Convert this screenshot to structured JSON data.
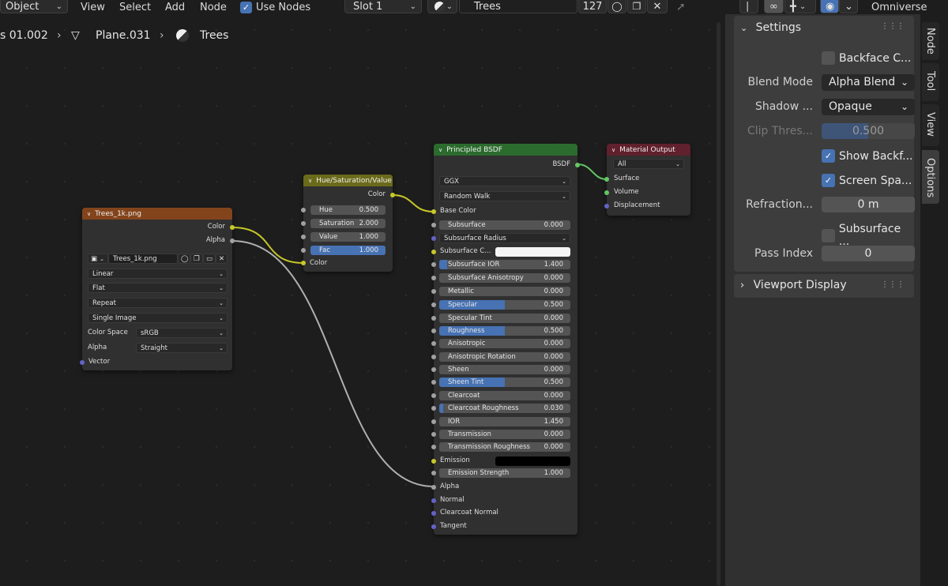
{
  "header": {
    "mode": "Object",
    "menus": [
      "View",
      "Select",
      "Add",
      "Node"
    ],
    "use_nodes_label": "Use Nodes",
    "slot": "Slot 1",
    "material_name": "Trees",
    "user_count": "127",
    "panel_label": "Omniverse"
  },
  "breadcrumb": {
    "item1": "s 01.002",
    "item2": "Plane.031",
    "item3": "Trees"
  },
  "image_node": {
    "title": "Trees_1k.png",
    "out_color": "Color",
    "out_alpha": "Alpha",
    "image_name": "Trees_1k.png",
    "interpolation": "Linear",
    "projection": "Flat",
    "extension": "Repeat",
    "source": "Single Image",
    "color_space_label": "Color Space",
    "color_space": "sRGB",
    "alpha_label": "Alpha",
    "alpha_mode": "Straight",
    "in_vector": "Vector"
  },
  "hsv_node": {
    "title": "Hue/Saturation/Value",
    "out_color": "Color",
    "hue_label": "Hue",
    "hue": "0.500",
    "sat_label": "Saturation",
    "sat": "2.000",
    "val_label": "Value",
    "val": "1.000",
    "fac_label": "Fac",
    "fac": "1.000",
    "in_color": "Color"
  },
  "bsdf_node": {
    "title": "Principled BSDF",
    "out_bsdf": "BSDF",
    "distribution": "GGX",
    "subsurface_method": "Random Walk",
    "base_color": "Base Color",
    "subsurface_radius": "Subsurface Radius",
    "subsurface_color": "Subsurface C...",
    "emission": "Emission",
    "alpha": "Alpha",
    "normal": "Normal",
    "clearcoat_normal": "Clearcoat Normal",
    "tangent": "Tangent",
    "fields": [
      {
        "label": "Subsurface",
        "value": "0.000",
        "fill": 0
      },
      {
        "label": "Subsurface IOR",
        "value": "1.400",
        "fill": 0.06
      },
      {
        "label": "Subsurface Anisotropy",
        "value": "0.000",
        "fill": 0
      },
      {
        "label": "Metallic",
        "value": "0.000",
        "fill": 0
      },
      {
        "label": "Specular",
        "value": "0.500",
        "fill": 0.5
      },
      {
        "label": "Specular Tint",
        "value": "0.000",
        "fill": 0
      },
      {
        "label": "Roughness",
        "value": "0.500",
        "fill": 0.5
      },
      {
        "label": "Anisotropic",
        "value": "0.000",
        "fill": 0
      },
      {
        "label": "Anisotropic Rotation",
        "value": "0.000",
        "fill": 0
      },
      {
        "label": "Sheen",
        "value": "0.000",
        "fill": 0
      },
      {
        "label": "Sheen Tint",
        "value": "0.500",
        "fill": 0.5
      },
      {
        "label": "Clearcoat",
        "value": "0.000",
        "fill": 0
      },
      {
        "label": "Clearcoat Roughness",
        "value": "0.030",
        "fill": 0.03
      },
      {
        "label": "IOR",
        "value": "1.450",
        "fill": 0
      },
      {
        "label": "Transmission",
        "value": "0.000",
        "fill": 0
      },
      {
        "label": "Transmission Roughness",
        "value": "0.000",
        "fill": 0
      },
      {
        "label": "Emission Strength",
        "value": "1.000",
        "fill": 0
      }
    ]
  },
  "output_node": {
    "title": "Material Output",
    "target": "All",
    "surface": "Surface",
    "volume": "Volume",
    "displacement": "Displacement"
  },
  "settings": {
    "title": "Settings",
    "backface_culling": "Backface C...",
    "blend_mode_label": "Blend Mode",
    "blend_mode": "Alpha Blend",
    "shadow_label": "Shadow ...",
    "shadow_mode": "Opaque",
    "clip_label": "Clip Thres...",
    "clip_value": "0.500",
    "clip_fill": 0.5,
    "show_backface": "Show Backf...",
    "screen_space": "Screen Spa...",
    "refraction_label": "Refraction...",
    "refraction_value": "0 m",
    "subsurface_translucency": "Subsurface ...",
    "pass_index_label": "Pass Index",
    "pass_index": "0",
    "viewport_display": "Viewport Display"
  },
  "tabs": [
    "Node",
    "Tool",
    "View",
    "Options"
  ],
  "colors": {
    "image_header": "#83441c",
    "hsv_header": "#6a6a1b",
    "bsdf_header": "#2b6b2d",
    "output_header": "#60202c",
    "accent": "#4772b3"
  }
}
